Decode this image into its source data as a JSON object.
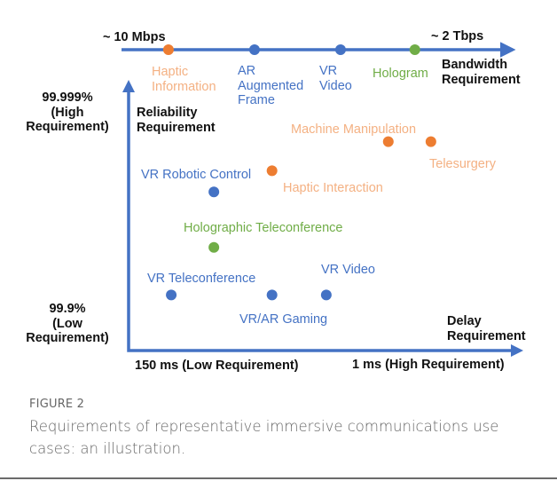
{
  "colors": {
    "axis": "#4472c4",
    "blue": "#4472c4",
    "orange": "#ed7d31",
    "orange_label": "#f4b183",
    "green": "#70ad47",
    "green_label": "#70ad47",
    "blue_label": "#4472c4"
  },
  "bandwidth_axis": {
    "low_label": "~ 10 Mbps",
    "high_label": "~ 2 Tbps",
    "title_line1": "Bandwidth",
    "title_line2": "Requirement"
  },
  "reliability_axis": {
    "high_line1": "99.999%",
    "high_line2": "(High",
    "high_line3": "Requirement)",
    "low_line1": "99.9%",
    "low_line2": "(Low",
    "low_line3": "Requirement)",
    "title_line1": "Reliability",
    "title_line2": "Requirement"
  },
  "delay_axis": {
    "low_label": "150 ms (Low Requirement)",
    "high_label": "1 ms (High Requirement)",
    "title_line1": "Delay",
    "title_line2": "Requirement"
  },
  "chart_data": {
    "type": "scatter",
    "title": "",
    "bandwidth_series": {
      "axis_range": [
        "~ 10 Mbps",
        "~ 2 Tbps"
      ],
      "points": [
        {
          "name": "Haptic Information",
          "label_lines": [
            "Haptic",
            "Information"
          ],
          "position": 0.12,
          "color": "orange"
        },
        {
          "name": "AR Augmented Frame",
          "label_lines": [
            "AR",
            "Augmented",
            "Frame"
          ],
          "position": 0.34,
          "color": "blue"
        },
        {
          "name": "VR Video",
          "label_lines": [
            "VR",
            "Video"
          ],
          "position": 0.56,
          "color": "blue"
        },
        {
          "name": "Hologram",
          "label_lines": [
            "Hologram"
          ],
          "position": 0.75,
          "color": "green"
        }
      ]
    },
    "delay_reliability_series": {
      "xlabel": "Delay Requirement",
      "ylabel": "Reliability Requirement",
      "xrange": [
        "150 ms (Low Requirement)",
        "1 ms (High Requirement)"
      ],
      "yrange": [
        "99.9% (Low Requirement)",
        "99.999% (High Requirement)"
      ],
      "points": [
        {
          "name": "Machine Manipulation",
          "x": 0.67,
          "y": 0.79,
          "color": "orange"
        },
        {
          "name": "Telesurgery",
          "x": 0.78,
          "y": 0.79,
          "color": "orange"
        },
        {
          "name": "Haptic Interaction",
          "x": 0.37,
          "y": 0.68,
          "color": "orange"
        },
        {
          "name": "VR Robotic Control",
          "x": 0.22,
          "y": 0.6,
          "color": "blue"
        },
        {
          "name": "Holographic Teleconference",
          "x": 0.22,
          "y": 0.39,
          "color": "green"
        },
        {
          "name": "VR Teleconference",
          "x": 0.11,
          "y": 0.21,
          "color": "blue"
        },
        {
          "name": "VR/AR Gaming",
          "x": 0.37,
          "y": 0.21,
          "color": "blue"
        },
        {
          "name": "VR Video",
          "x": 0.51,
          "y": 0.21,
          "color": "blue"
        }
      ]
    }
  },
  "caption": {
    "figure_label": "FIGURE 2",
    "text": "Requirements of representative immersive communications use cases: an illustration."
  }
}
